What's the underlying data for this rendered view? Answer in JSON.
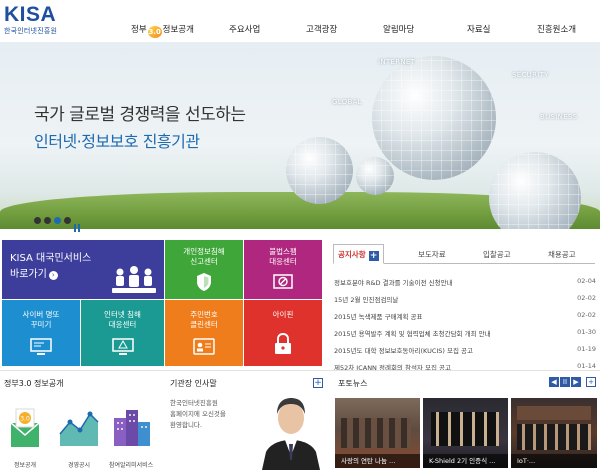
{
  "logo": {
    "main": "KISA",
    "sub": "한국인터넷진흥원"
  },
  "nav": {
    "gov_pre": "정부",
    "gov_badge": "3.0",
    "gov_post": "정보공개",
    "items": [
      "주요사업",
      "고객광장",
      "알림마당",
      "자료실",
      "진흥원소개"
    ]
  },
  "hero": {
    "line1": "국가 글로벌 경쟁력을 선도하는",
    "line2": "인터넷·정보보호 진흥기관",
    "labels": [
      "INTERNET",
      "GLOBAL",
      "SECURITY",
      "BUSINESS"
    ],
    "slide_count": 4,
    "active_slide": 3
  },
  "services": {
    "big": {
      "line1": "KISA 대국민서비스",
      "line2": "바로가기",
      "arrow": "›"
    },
    "tiles": [
      {
        "line1": "개인정보침해",
        "line2": "신고센터",
        "color": "#3fa73a"
      },
      {
        "line1": "불법스팸",
        "line2": "대응센터",
        "color": "#b0277f"
      },
      {
        "line1": "사이버 명또",
        "line2": "꾸미기",
        "color": "#1d8fd0"
      },
      {
        "line1": "인터넷 침해",
        "line2": "대응센터",
        "color": "#1a9a92"
      },
      {
        "line1": "주민번호",
        "line2": "클린센터",
        "color": "#f07d1b"
      },
      {
        "line1": "아이핀",
        "line2": "",
        "color": "#e0322c"
      }
    ]
  },
  "news": {
    "tabs": [
      "공지사항",
      "보도자료",
      "입찰공고",
      "채용공고"
    ],
    "plus": "+",
    "items": [
      {
        "title": "정보호분야 R&D 결과를 기술이전 신청안내",
        "date": "02-04"
      },
      {
        "title": "15년 2월 인진점검의날",
        "date": "02-02"
      },
      {
        "title": "2015년 녹색제품 구매계획 공표",
        "date": "02-02"
      },
      {
        "title": "2015년 용역발주 계획 및 협력업체 초청간담회 개최 안내",
        "date": "01-30"
      },
      {
        "title": "2015년도 대학 정보보호동아리(KUCIS) 모집 공고",
        "date": "01-19"
      },
      {
        "title": "제52차 ICANN 정례회의 참석자 모집 공고",
        "date": "01-14"
      }
    ]
  },
  "gov": {
    "title_pre": "정부",
    "title_post": "3.0 정보공개",
    "labels": [
      "정보공개",
      "경영공시",
      "참여알리미서비스"
    ]
  },
  "ceo": {
    "title": "기관장 인사말",
    "lines": [
      "한국인터넷진흥원",
      "홈페이지에 오신것을",
      "환영합니다."
    ],
    "plus": "+"
  },
  "photos": {
    "title": "포토뉴스",
    "controls": [
      "◀",
      "II",
      "▶",
      "+"
    ],
    "captions": [
      "사랑의 연탄 나눔 ...",
      "K-Shield 2기 인증식 ...",
      "IoT·..."
    ]
  }
}
